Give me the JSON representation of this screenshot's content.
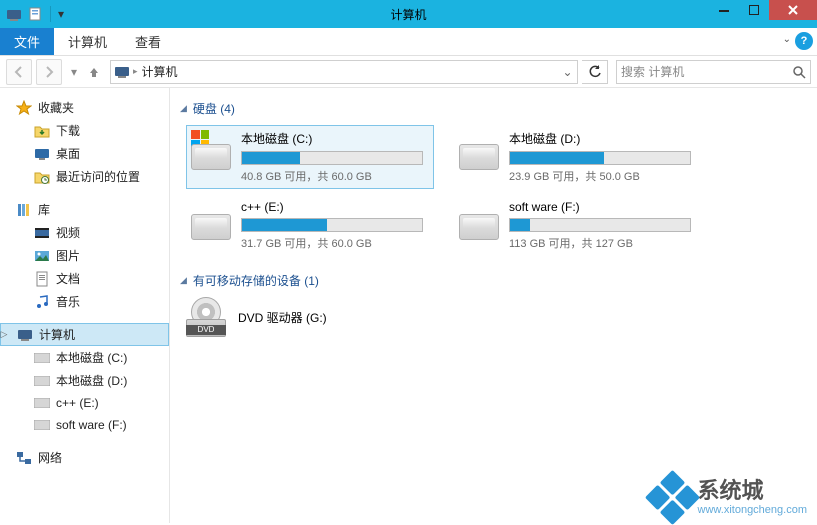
{
  "window": {
    "title": "计算机"
  },
  "ribbon": {
    "file": "文件",
    "tabs": [
      "计算机",
      "查看"
    ]
  },
  "address": {
    "location": "计算机"
  },
  "search": {
    "placeholder": "搜索 计算机"
  },
  "sidebar": {
    "favorites": {
      "label": "收藏夹",
      "items": [
        "下载",
        "桌面",
        "最近访问的位置"
      ]
    },
    "libraries": {
      "label": "库",
      "items": [
        "视频",
        "图片",
        "文档",
        "音乐"
      ]
    },
    "computer": {
      "label": "计算机",
      "items": [
        "本地磁盘 (C:)",
        "本地磁盘 (D:)",
        "c++ (E:)",
        "soft ware (F:)"
      ]
    },
    "network": {
      "label": "网络"
    }
  },
  "sections": {
    "hdd": {
      "label": "硬盘 (4)"
    },
    "removable": {
      "label": "有可移动存储的设备 (1)"
    }
  },
  "drives": [
    {
      "name": "本地磁盘 (C:)",
      "sub": "40.8 GB 可用，共 60.0 GB",
      "used_pct": 32,
      "selected": true,
      "winflag": true
    },
    {
      "name": "本地磁盘 (D:)",
      "sub": "23.9 GB 可用，共 50.0 GB",
      "used_pct": 52
    },
    {
      "name": "c++ (E:)",
      "sub": "31.7 GB 可用，共 60.0 GB",
      "used_pct": 47
    },
    {
      "name": "soft ware (F:)",
      "sub": "113 GB 可用，共 127 GB",
      "used_pct": 11
    }
  ],
  "dvd": {
    "name": "DVD 驱动器 (G:)",
    "badge": "DVD"
  },
  "watermark": {
    "brand": "系统城",
    "url": "www.xitongcheng.com"
  }
}
